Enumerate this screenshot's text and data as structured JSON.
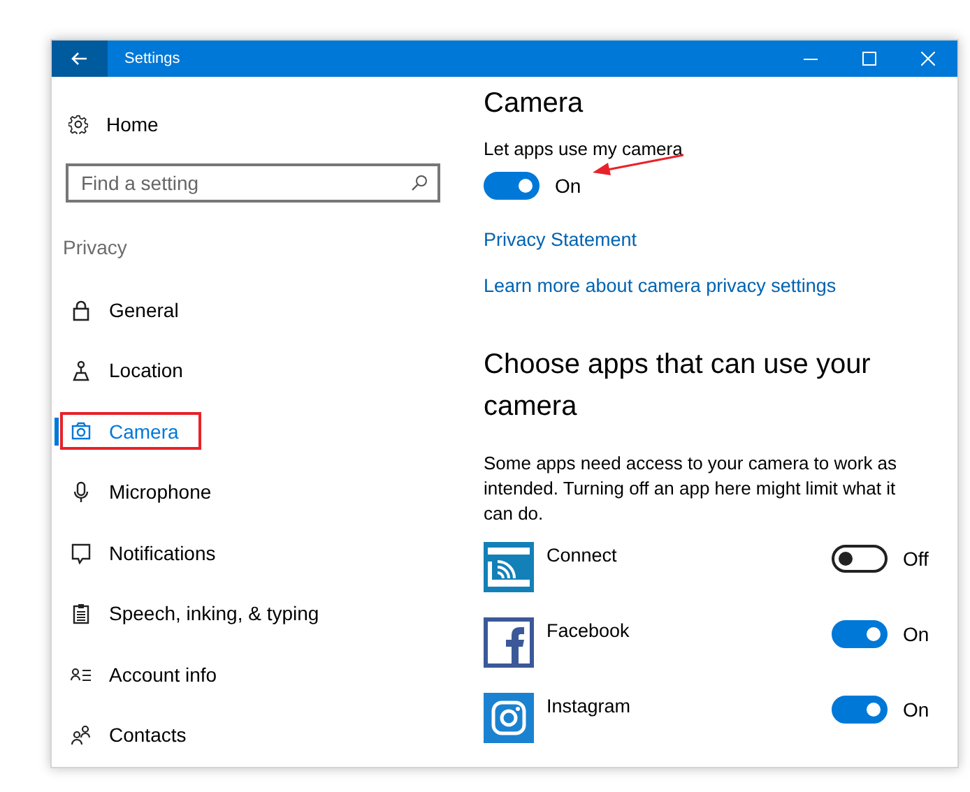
{
  "window": {
    "title": "Settings"
  },
  "sidebar": {
    "home": "Home",
    "search": {
      "placeholder": "Find a setting"
    },
    "section": "Privacy",
    "items": [
      {
        "label": "General",
        "selected": false
      },
      {
        "label": "Location",
        "selected": false
      },
      {
        "label": "Camera",
        "selected": true
      },
      {
        "label": "Microphone",
        "selected": false
      },
      {
        "label": "Notifications",
        "selected": false
      },
      {
        "label": "Speech, inking, & typing",
        "selected": false
      },
      {
        "label": "Account info",
        "selected": false
      },
      {
        "label": "Contacts",
        "selected": false
      }
    ]
  },
  "content": {
    "title": "Camera",
    "master": {
      "label": "Let apps use my camera",
      "on": true,
      "state": "On"
    },
    "links": [
      "Privacy Statement",
      "Learn more about camera privacy settings"
    ],
    "section_title": "Choose apps that can use your camera",
    "description": "Some apps need access to your camera to work as intended. Turning off an app here might limit what it can do.",
    "apps": [
      {
        "name": "Connect",
        "on": false,
        "state": "Off"
      },
      {
        "name": "Facebook",
        "on": true,
        "state": "On"
      },
      {
        "name": "Instagram",
        "on": true,
        "state": "On"
      }
    ]
  }
}
